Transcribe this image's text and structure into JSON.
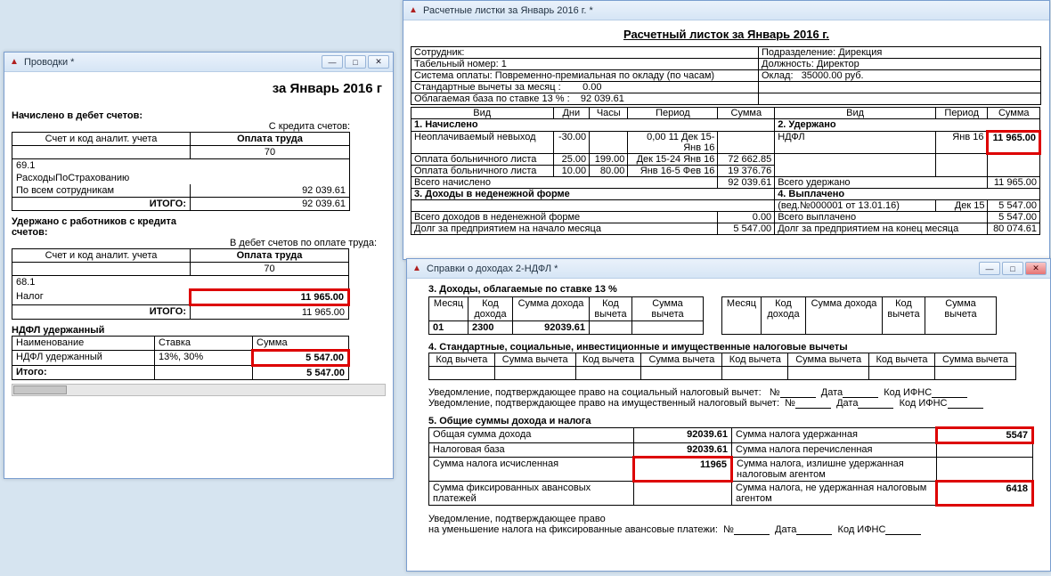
{
  "w1": {
    "title": "Проводки  *",
    "heading": "за Январь 2016 г",
    "sect1": "Начислено в дебет счетов:",
    "sub1": "С кредита счетов:",
    "col_acct": "Счет и код аналит. учета",
    "col_pay": "Оплата труда",
    "col_pay_code": "70",
    "r1_acct": "69.1",
    "r1_name": "РасходыПоСтрахованию",
    "r2_name": "По всем сотрудникам",
    "r2_val": "92 039.61",
    "itogo": "ИТОГО:",
    "itogo_val": "92 039.61",
    "sect2": "Удержано с работников с кредита счетов:",
    "sub2": "В дебет счетов по оплате труда:",
    "col2_code": "70",
    "r3_acct": "68.1",
    "r3_name": "Налог",
    "r3_val": "11 965.00",
    "itogo2_val": "11 965.00",
    "sect3": "НДФЛ удержанный",
    "h_name": "Наименование",
    "h_rate": "Ставка",
    "h_sum": "Сумма",
    "ndfl_row_name": "НДФЛ удержанный",
    "ndfl_row_rate": "13%, 30%",
    "ndfl_row_sum": "5 547.00",
    "ndfl_total": "Итого:",
    "ndfl_total_sum": "5 547.00"
  },
  "w2": {
    "title": "Расчетные листки за Январь 2016 г.   *",
    "heading": "Расчетный листок за Январь 2016 г.",
    "emp_label": "Сотрудник:",
    "tabnum_label": "Табельный номер:",
    "tabnum": "1",
    "dept_label": "Подразделение:",
    "dept": "Дирекция",
    "post_label": "Должность:",
    "post": "Директор",
    "paysys_label": "Система оплаты:",
    "paysys": "Повременно-премиальная по окладу (по часам)",
    "salary_label": "Оклад:",
    "salary": "35000.00 руб.",
    "stdded_label": "Стандартные вычеты за месяц :",
    "stdded": "0.00",
    "base13_label": "Облагаемая база по ставке 13 % :",
    "base13": "92 039.61",
    "h_vid": "Вид",
    "h_days": "Дни",
    "h_hours": "Часы",
    "h_period": "Период",
    "h_sum": "Сумма",
    "s1": "1. Начислено",
    "s2": "2. Удержано",
    "r_ndfl": "НДФЛ",
    "r_ndfl_period": "Янв 16",
    "r_ndfl_sum": "11 965.00",
    "r_nev": "Неоплачиваемый невыход",
    "r_nev_days": "-30.00",
    "r_nev_hours": "",
    "r_nev_period": "0,00 11 Дек 15-Янв 16",
    "r_nev_sum": "",
    "r_b1": "Оплата больничного листа",
    "r_b1_days": "25.00",
    "r_b1_hours": "199.00",
    "r_b1_period": "Дек 15-24 Янв 16",
    "r_b1_sum": "72 662.85",
    "r_b2": "Оплата больничного листа",
    "r_b2_days": "10.00",
    "r_b2_hours": "80.00",
    "r_b2_period": "Янв 16-5 Фев 16",
    "r_b2_sum": "19 376.76",
    "r_tot_nach": "Всего начислено",
    "r_tot_nach_sum": "92 039.61",
    "r_tot_ud": "Всего удержано",
    "r_tot_ud_sum": "11 965.00",
    "s3": "3. Доходы в неденежной форме",
    "s4": "4. Выплачено",
    "r_ved": "(вед.№000001 от 13.01.16)",
    "r_ved_period": "Дек 15",
    "r_ved_sum": "5 547.00",
    "r_tot_dn": "Всего доходов в неденежной форме",
    "r_tot_dn_sum": "0.00",
    "r_tot_vy": "Всего выплачено",
    "r_tot_vy_sum": "5 547.00",
    "r_dolg_start": "Долг за предприятием на начало месяца",
    "r_dolg_start_sum": "5 547.00",
    "r_dolg_end": "Долг за предприятием  на конец месяца",
    "r_dolg_end_sum": "80 074.61"
  },
  "w3": {
    "title": "Справки о доходах 2-НДФЛ  *",
    "s3": "3. Доходы, облагаемые по ставке       13      %",
    "h_mon": "Месяц",
    "h_inccode": "Код дохода",
    "h_incsum": "Сумма дохода",
    "h_dedcode": "Код вычета",
    "h_dedsum": "Сумма вычета",
    "r_mon": "01",
    "r_inccode": "2300",
    "r_incsum": "92039.61",
    "s4": "4. Стандартные, социальные, инвестиционные и имущественные налоговые вычеты",
    "notice1": "Уведомление, подтверждающее право на социальный налоговый вычет:",
    "notice2": "Уведомление, подтверждающее право на имущественный налоговый вычет:",
    "l_no": "№",
    "l_date": "Дата",
    "l_ifns": "Код ИФНС",
    "s5": "5. Общие суммы дохода и налога",
    "r_totinc": "Общая сумма дохода",
    "r_totinc_v": "92039.61",
    "r_taxbase": "Налоговая база",
    "r_taxbase_v": "92039.61",
    "r_taxcalc": "Сумма налога исчисленная",
    "r_taxcalc_v": "11965",
    "r_fixadv": "Сумма фиксированных авансовых платежей",
    "r_taxhold": "Сумма налога удержанная",
    "r_taxhold_v": "5547",
    "r_taxpaid": "Сумма налога перечисленная",
    "r_taxover": "Сумма налога, излишне удержанная налоговым агентом",
    "r_taxnot": "Сумма налога, не удержанная налоговым агентом",
    "r_taxnot_v": "6418",
    "notice3a": "Уведомление, подтверждающее право",
    "notice3b": "на уменьшение налога на фиксированные авансовые платежи:"
  }
}
